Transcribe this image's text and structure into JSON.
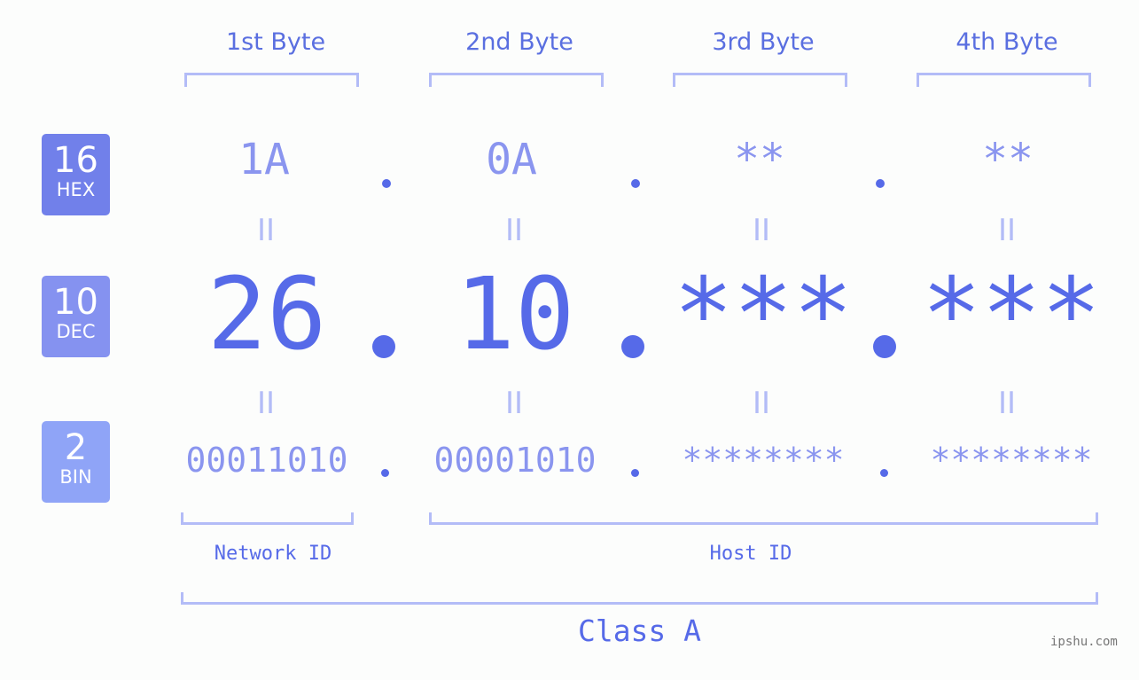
{
  "byte_headers": [
    "1st Byte",
    "2nd Byte",
    "3rd Byte",
    "4th Byte"
  ],
  "badges": [
    {
      "num": "16",
      "label": "HEX",
      "color": "#7180ea"
    },
    {
      "num": "10",
      "label": "DEC",
      "color": "#8592f0"
    },
    {
      "num": "2",
      "label": "BIN",
      "color": "#8fa4f7"
    }
  ],
  "hex": [
    "1A",
    "0A",
    "**",
    "**"
  ],
  "dec": [
    "26",
    "10",
    "***",
    "***"
  ],
  "bin": [
    "00011010",
    "00001010",
    "********",
    "********"
  ],
  "separator": ".",
  "equals": "II",
  "network_label": "Network ID",
  "host_label": "Host ID",
  "class_label": "Class A",
  "watermark": "ipshu.com",
  "colors": {
    "accent": "#566ae8",
    "light": "#8a95ef",
    "bracket": "#b3bcf7"
  }
}
